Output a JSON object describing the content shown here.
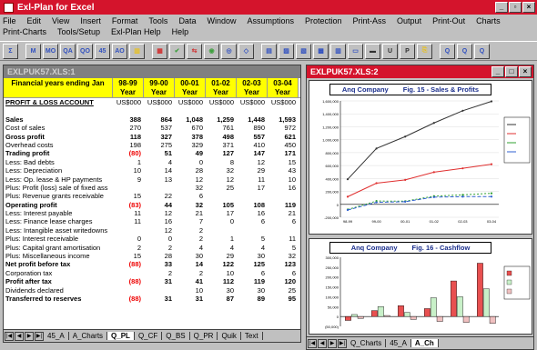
{
  "app": {
    "title": "Exl-Plan for Excel"
  },
  "menu": [
    "File",
    "Edit",
    "View",
    "Insert",
    "Format",
    "Tools",
    "Data",
    "Window",
    "Assumptions",
    "Protection",
    "Print-Ass",
    "Output",
    "Print-Out",
    "Charts",
    "Print-Charts",
    "Tools/Setup",
    "Exl-Plan Help",
    "Help"
  ],
  "toolbar": [
    "Σ",
    "M",
    "MO",
    "QA",
    "QO",
    "45",
    "AO",
    "▥",
    "▦",
    "✔",
    "⇆",
    "◉",
    "◎",
    "◇",
    "▤",
    "▨",
    "▧",
    "▩",
    "▥",
    "▭",
    "▬",
    "U",
    "P",
    "⎘",
    "Q",
    "Q",
    "Q"
  ],
  "left_window": {
    "title": "EXLPUK57.XLS:1",
    "header_label": "Financial years ending Jan",
    "years": [
      [
        "98-99",
        "Year"
      ],
      [
        "99-00",
        "Year"
      ],
      [
        "00-01",
        "Year"
      ],
      [
        "01-02",
        "Year"
      ],
      [
        "02-03",
        "Year"
      ],
      [
        "03-04",
        "Year"
      ]
    ],
    "currency_row": {
      "label": "PROFIT & LOSS ACCOUNT",
      "values": [
        "US$000",
        "US$000",
        "US$000",
        "US$000",
        "US$000",
        "US$000"
      ]
    },
    "rows": [
      {
        "label": "",
        "values": [
          "",
          "",
          "",
          "",
          "",
          ""
        ],
        "style": ""
      },
      {
        "label": "Sales",
        "values": [
          "388",
          "864",
          "1,048",
          "1,259",
          "1,448",
          "1,593"
        ],
        "style": "bold"
      },
      {
        "label": "Cost of sales",
        "values": [
          "270",
          "537",
          "670",
          "761",
          "890",
          "972"
        ],
        "style": ""
      },
      {
        "label": "Gross profit",
        "values": [
          "118",
          "327",
          "378",
          "498",
          "557",
          "621"
        ],
        "style": "bold"
      },
      {
        "label": "Overhead costs",
        "values": [
          "198",
          "275",
          "329",
          "371",
          "410",
          "450"
        ],
        "style": ""
      },
      {
        "label": "Trading profit",
        "values": [
          "(80)",
          "51",
          "49",
          "127",
          "147",
          "171"
        ],
        "style": "bold"
      },
      {
        "label": "Less: Bad debts",
        "values": [
          "1",
          "4",
          "0",
          "8",
          "12",
          "15"
        ],
        "style": ""
      },
      {
        "label": "Less: Depreciation",
        "values": [
          "10",
          "14",
          "28",
          "32",
          "29",
          "43"
        ],
        "style": ""
      },
      {
        "label": "Less: Op. lease & HP payments",
        "values": [
          "9",
          "13",
          "12",
          "12",
          "11",
          "10"
        ],
        "style": ""
      },
      {
        "label": "Plus: Profit (loss) sale of fixed ass",
        "values": [
          "",
          "",
          "32",
          "25",
          "17",
          "16"
        ],
        "style": ""
      },
      {
        "label": "Plus: Revenue grants receivable",
        "values": [
          "15",
          "22",
          "6",
          "",
          "",
          ""
        ],
        "style": ""
      },
      {
        "label": "Operating profit",
        "values": [
          "(83)",
          "44",
          "32",
          "105",
          "108",
          "119"
        ],
        "style": "bold"
      },
      {
        "label": "Less: Interest payable",
        "values": [
          "11",
          "12",
          "21",
          "17",
          "16",
          "21"
        ],
        "style": ""
      },
      {
        "label": "Less: Finance lease charges",
        "values": [
          "11",
          "16",
          "7",
          "0",
          "6",
          "6"
        ],
        "style": ""
      },
      {
        "label": "Less: Intangible asset writedowns",
        "values": [
          "",
          "12",
          "2",
          "",
          "",
          ""
        ],
        "style": ""
      },
      {
        "label": "Plus: Interest receivable",
        "values": [
          "0",
          "0",
          "2",
          "1",
          "5",
          "11"
        ],
        "style": ""
      },
      {
        "label": "Plus: Capital grant amortisation",
        "values": [
          "2",
          "2",
          "4",
          "4",
          "4",
          "5"
        ],
        "style": ""
      },
      {
        "label": "Plus: Miscellaneous income",
        "values": [
          "15",
          "28",
          "30",
          "29",
          "30",
          "32"
        ],
        "style": ""
      },
      {
        "label": "Net profit before tax",
        "values": [
          "(88)",
          "33",
          "14",
          "122",
          "125",
          "123"
        ],
        "style": "bold"
      },
      {
        "label": "Corporation tax",
        "values": [
          "",
          "2",
          "2",
          "10",
          "6",
          "6"
        ],
        "style": ""
      },
      {
        "label": "Profit after tax",
        "values": [
          "(88)",
          "31",
          "41",
          "112",
          "119",
          "120"
        ],
        "style": "bold"
      },
      {
        "label": "Dividends declared",
        "values": [
          "",
          "",
          "10",
          "30",
          "30",
          "25"
        ],
        "style": ""
      },
      {
        "label": "Transferred to reserves",
        "values": [
          "(88)",
          "31",
          "31",
          "87",
          "89",
          "95"
        ],
        "style": "bold"
      }
    ],
    "tabs": [
      "45_A",
      "A_Charts",
      "Q_PL",
      "Q_CF",
      "Q_BS",
      "Q_PR",
      "Quik",
      "Text"
    ],
    "active_tab": "Q_PL"
  },
  "right_window": {
    "title": "EXLPUK57.XLS:2",
    "chart1": {
      "company": "Anq Company",
      "figure": "Fig. 15 - Sales & Profits"
    },
    "chart2": {
      "company": "Anq Company",
      "figure": "Fig. 16 - Cashflow"
    },
    "tabs": [
      "Q_Charts",
      "45_A",
      "A_Ch"
    ]
  },
  "chart_data": [
    {
      "type": "line",
      "title": "Fig. 15 - Sales & Profits",
      "x": [
        "98-99",
        "99-00",
        "00-01",
        "01-02",
        "02-03",
        "03-04"
      ],
      "ylim": [
        -200,
        1600
      ],
      "yticks": [
        "1,600,000",
        "1,400,000",
        "1,200,000",
        "1,000,000",
        "800,000",
        "600,000",
        "400,000",
        "200,000",
        "0",
        "-200,000"
      ],
      "series": [
        {
          "values": [
            388,
            864,
            1048,
            1259,
            1448,
            1593
          ],
          "color": "#333333",
          "dash": ""
        },
        {
          "values": [
            118,
            327,
            378,
            498,
            557,
            621
          ],
          "color": "#e03030",
          "dash": ""
        },
        {
          "values": [
            -80,
            51,
            49,
            127,
            147,
            171
          ],
          "color": "#30a030",
          "dash": "2,2"
        },
        {
          "values": [
            -88,
            31,
            41,
            112,
            119,
            120
          ],
          "color": "#3060d0",
          "dash": "4,2"
        }
      ]
    },
    {
      "type": "bar",
      "title": "Fig. 16 - Cashflow",
      "categories": [
        "98-99",
        "99-00",
        "00-01",
        "01-02",
        "02-03",
        "03-04"
      ],
      "ylim": [
        -50,
        300
      ],
      "yticks": [
        "300,000",
        "250,000",
        "200,000",
        "150,000",
        "100,000",
        "50,000",
        "0",
        "(50,000)"
      ],
      "series": [
        {
          "values": [
            -20,
            30,
            55,
            40,
            180,
            270
          ],
          "color": "#e85050"
        },
        {
          "values": [
            10,
            50,
            20,
            95,
            100,
            140
          ],
          "color": "#c8f0c8"
        },
        {
          "values": [
            -10,
            5,
            -15,
            -25,
            -30,
            -35
          ],
          "color": "#f0c0c0"
        }
      ]
    }
  ]
}
